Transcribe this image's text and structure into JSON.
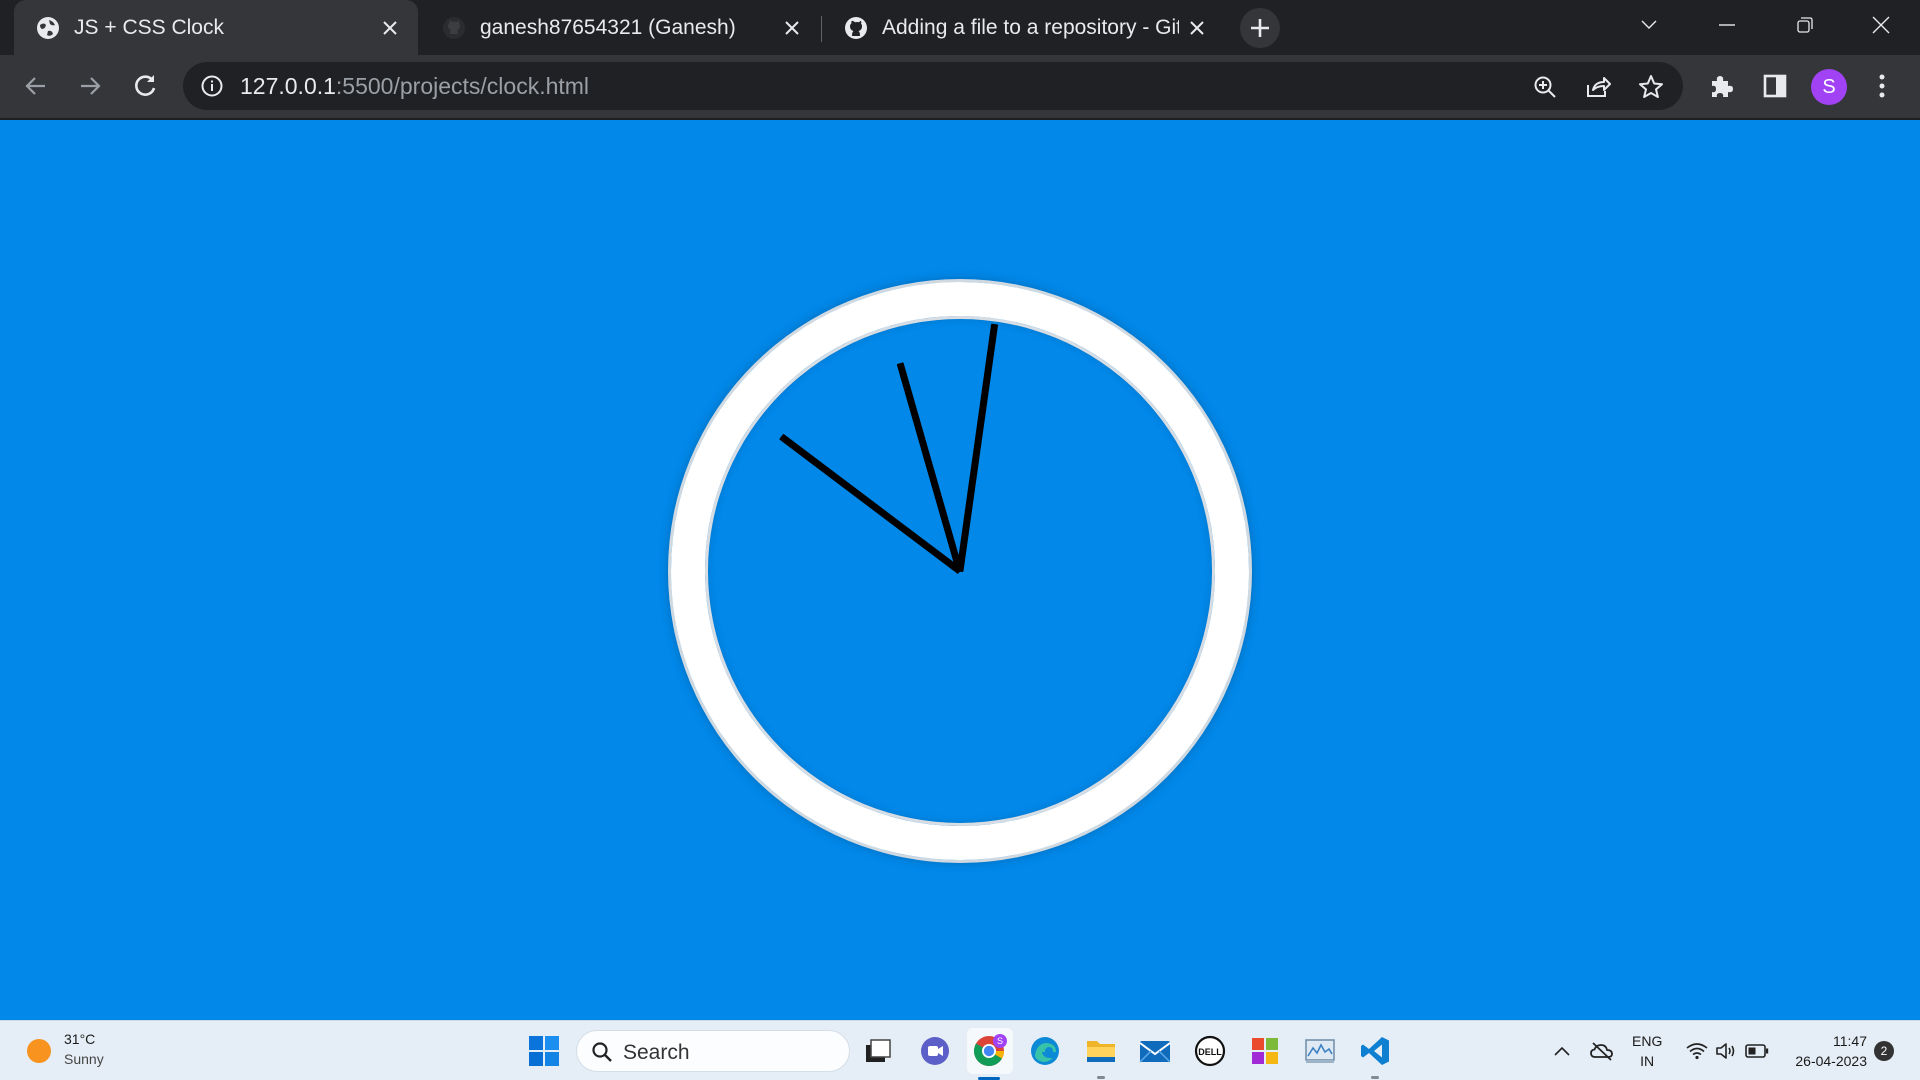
{
  "browser": {
    "tabs": [
      {
        "title": "JS + CSS Clock",
        "icon": "globe-icon",
        "active": true
      },
      {
        "title": "ganesh87654321 (Ganesh)",
        "icon": "github-icon",
        "active": false
      },
      {
        "title": "Adding a file to a repository - Git",
        "icon": "github-icon",
        "active": false
      }
    ],
    "address": {
      "host": "127.0.0.1",
      "path": ":5500/projects/clock.html"
    },
    "profile_initial": "S",
    "colors": {
      "frame": "#202124",
      "toolbar": "#35363a",
      "omnibox": "#202124",
      "avatar": "#a142f4"
    }
  },
  "page": {
    "background": "#0188e9",
    "clock": {
      "face_border": "#ffffff",
      "hands": [
        {
          "name": "hour-hand",
          "angle_deg": 254,
          "length_pct": 0.85
        },
        {
          "name": "minute-hand",
          "angle_deg": 278,
          "length_pct": 0.98
        },
        {
          "name": "second-hand",
          "angle_deg": 217,
          "length_pct": 0.88
        }
      ]
    }
  },
  "taskbar": {
    "weather": {
      "temp": "31°C",
      "condition": "Sunny"
    },
    "search_placeholder": "Search",
    "apps": [
      "task-view-icon",
      "teams-chat-icon",
      "chrome-icon",
      "edge-icon",
      "file-explorer-icon",
      "mail-icon",
      "dell-icon",
      "office-icon",
      "monitor-app-icon",
      "vscode-icon"
    ],
    "tray": {
      "lang_line1": "ENG",
      "lang_line2": "IN",
      "time": "11:47",
      "date": "26-04-2023",
      "notifications": "2"
    }
  }
}
